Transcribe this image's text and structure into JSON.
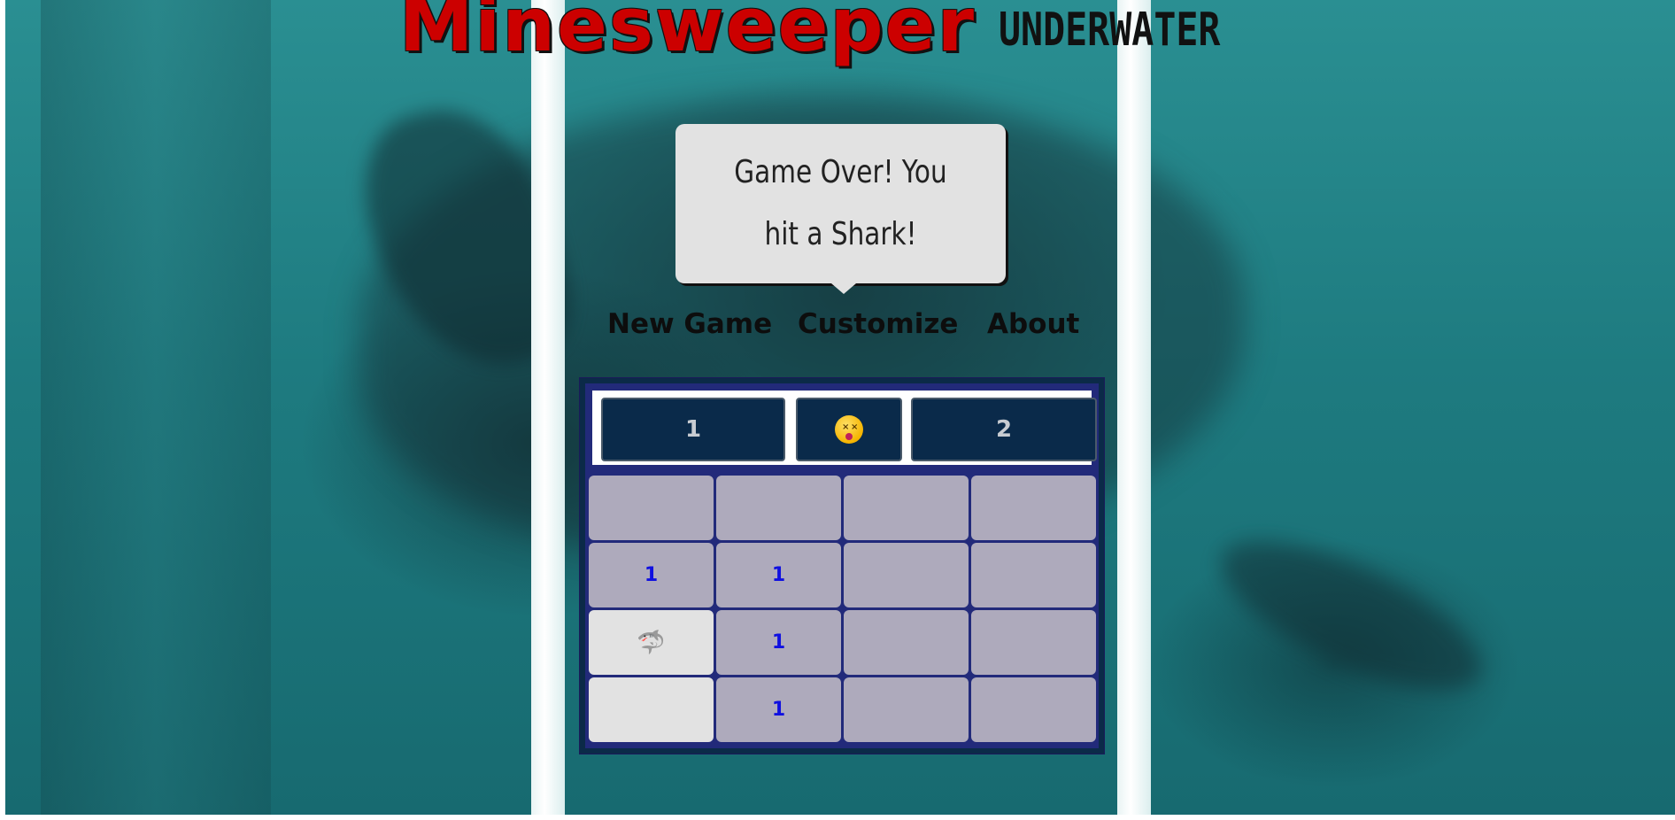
{
  "title": {
    "main": "Minesweeper",
    "sub": "UNDERWATER"
  },
  "popup": {
    "message": "Game Over! You hit a Shark!"
  },
  "nav": {
    "new_game": "New Game",
    "customize": "Customize",
    "about": "About"
  },
  "status": {
    "mines_count": "1",
    "face_icon": "dizzy-face-icon",
    "timer": "2"
  },
  "grid": {
    "rows": 4,
    "cols": 4,
    "cells": [
      [
        "",
        "",
        "",
        ""
      ],
      [
        "1",
        "1",
        "",
        ""
      ],
      [
        "shark",
        "1",
        "",
        ""
      ],
      [
        "empty",
        "1",
        "",
        ""
      ]
    ]
  },
  "colors": {
    "title_red": "#cc0000",
    "number_blue": "#1010e0",
    "board_navy": "#0b2a48",
    "board_frame": "#222a7a",
    "cell_hidden": "#aeaabc",
    "cell_revealed": "#e2e2e2",
    "counter_bg": "#0a2a4a"
  }
}
